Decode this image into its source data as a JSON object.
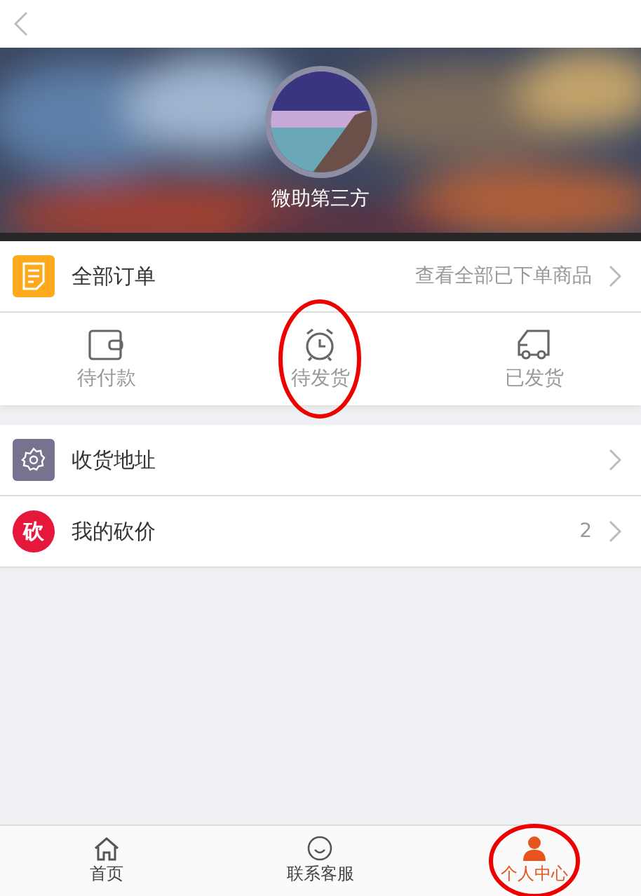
{
  "profile": {
    "name": "微助第三方"
  },
  "orders": {
    "title": "全部订单",
    "link": "查看全部已下单商品"
  },
  "order_status": [
    {
      "kind": "wallet",
      "label": "待付款",
      "circled": false
    },
    {
      "kind": "clock",
      "label": "待发货",
      "circled": true
    },
    {
      "kind": "truck",
      "label": "已发货",
      "circled": false
    }
  ],
  "menu": [
    {
      "kind": "gear",
      "label": "收货地址"
    },
    {
      "kind": "glyph",
      "glyph": "砍",
      "label": "我的砍价",
      "count": "2"
    }
  ],
  "tabbar": [
    {
      "kind": "home",
      "label": "首页",
      "selected": false,
      "circled": false
    },
    {
      "kind": "chat",
      "label": "联系客服",
      "selected": false,
      "circled": false
    },
    {
      "kind": "person",
      "label": "个人中心",
      "selected": true,
      "circled": true
    }
  ]
}
